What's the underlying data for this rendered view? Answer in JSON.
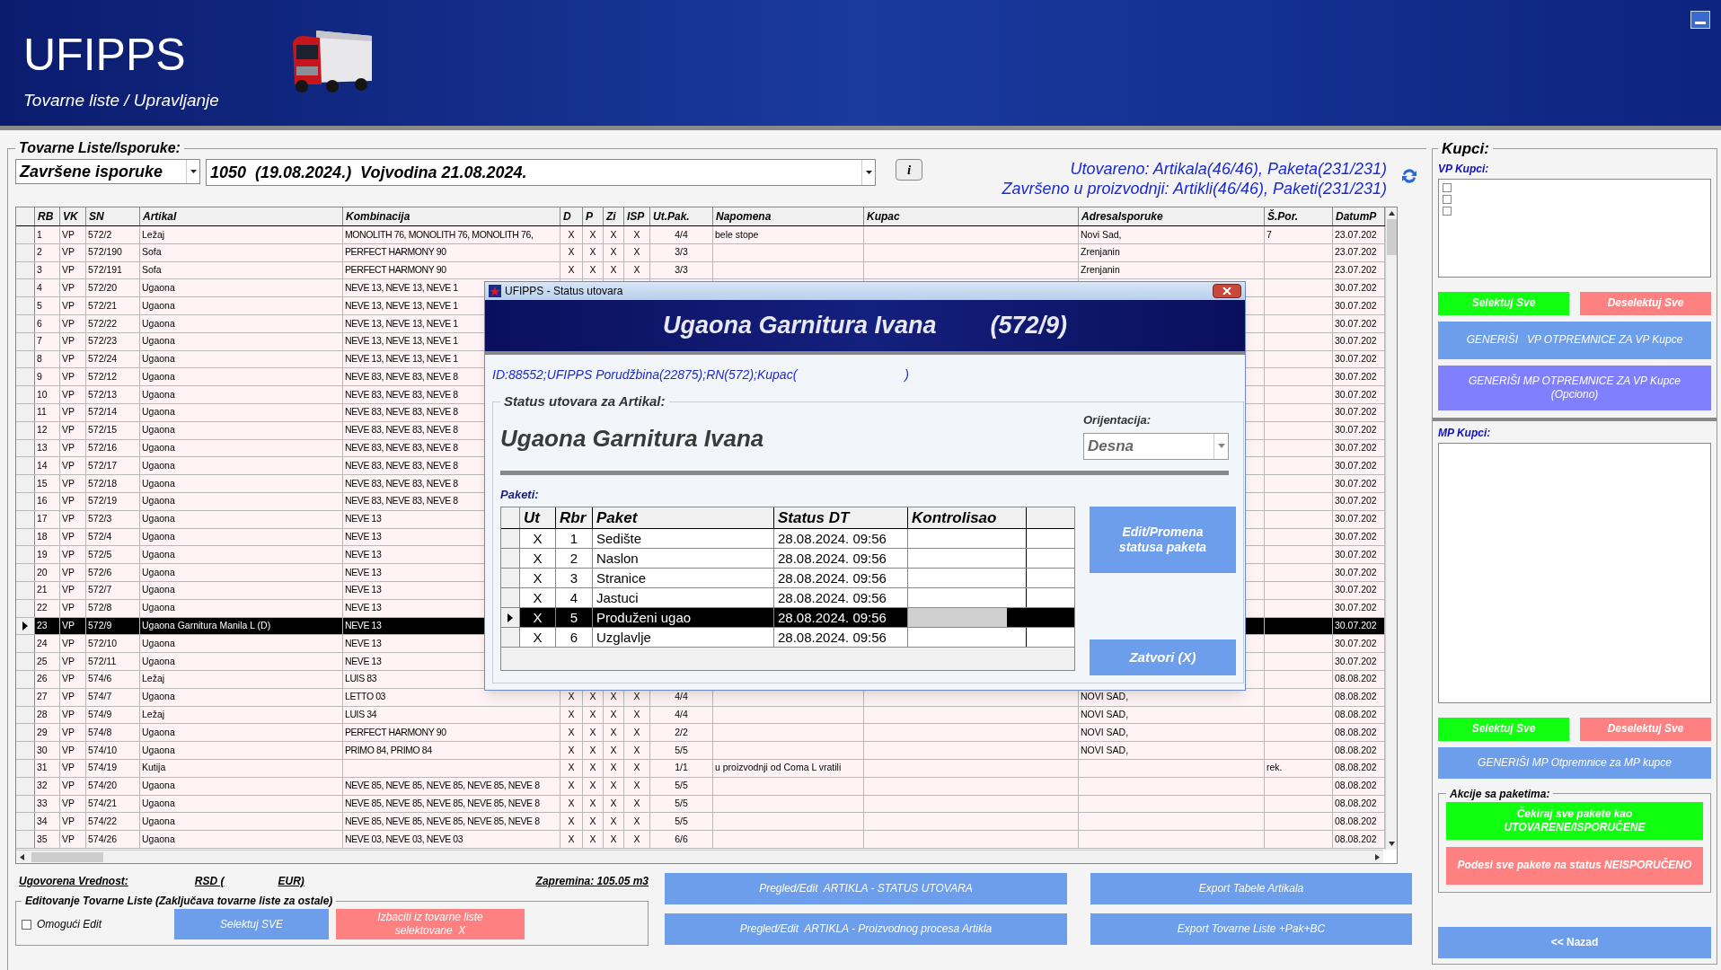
{
  "header": {
    "title": "UFIPPS",
    "subtitle": "Tovarne liste / Upravljanje"
  },
  "tovarne": {
    "legend": "Tovarne Liste/Isporuke:",
    "filter": "Završene isporuke",
    "list": "1050  (19.08.2024.)  Vojvodina 21.08.2024.",
    "info_button": "i",
    "status_1": "Utovareno: Artikala(46/46), Paketa(231/231)",
    "status_2": "Završeno u proizvodnji: Artikli(46/46), Paketi(231/231)"
  },
  "table": {
    "columns": [
      "RB",
      "VK",
      "SN",
      "Artikal",
      "Kombinacija",
      "D",
      "P",
      "Zi",
      "ISP",
      "Ut.Pak.",
      "Napomena",
      "Kupac",
      "Adresalsporuke",
      "Š.Por.",
      "DatumP"
    ],
    "rows": [
      {
        "rb": "1",
        "vk": "VP",
        "sn": "572/2",
        "artikal": "Ležaj",
        "kombinacija": "MONOLITH 76, MONOLITH 76, MONOLITH 76,",
        "d": "X",
        "p": "X",
        "zi": "X",
        "isp": "X",
        "ut_pak": "4/4",
        "napomena": "bele stope",
        "adresa": "Novi Sad,",
        "s_por": "7",
        "datum": "23.07.202",
        "selected": false
      },
      {
        "rb": "2",
        "vk": "VP",
        "sn": "572/190",
        "artikal": "Sofa",
        "kombinacija": "PERFECT HARMONY 90",
        "d": "X",
        "p": "X",
        "zi": "X",
        "isp": "X",
        "ut_pak": "3/3",
        "adresa": "Zrenjanin",
        "datum": "23.07.202",
        "selected": false
      },
      {
        "rb": "3",
        "vk": "VP",
        "sn": "572/191",
        "artikal": "Sofa",
        "kombinacija": "PERFECT HARMONY 90",
        "d": "X",
        "p": "X",
        "zi": "X",
        "isp": "X",
        "ut_pak": "3/3",
        "adresa": "Zrenjanin",
        "datum": "23.07.202",
        "selected": false
      },
      {
        "rb": "4",
        "vk": "VP",
        "sn": "572/20",
        "artikal": "Ugaona",
        "kombinacija": "NEVE 13, NEVE 13, NEVE 1",
        "datum": "30.07.202",
        "selected": false
      },
      {
        "rb": "5",
        "vk": "VP",
        "sn": "572/21",
        "artikal": "Ugaona",
        "kombinacija": "NEVE 13, NEVE 13, NEVE 1",
        "datum": "30.07.202",
        "selected": false
      },
      {
        "rb": "6",
        "vk": "VP",
        "sn": "572/22",
        "artikal": "Ugaona",
        "kombinacija": "NEVE 13, NEVE 13, NEVE 1",
        "datum": "30.07.202",
        "selected": false
      },
      {
        "rb": "7",
        "vk": "VP",
        "sn": "572/23",
        "artikal": "Ugaona",
        "kombinacija": "NEVE 13, NEVE 13, NEVE 1",
        "datum": "30.07.202",
        "selected": false
      },
      {
        "rb": "8",
        "vk": "VP",
        "sn": "572/24",
        "artikal": "Ugaona",
        "kombinacija": "NEVE 13, NEVE 13, NEVE 1",
        "datum": "30.07.202",
        "selected": false
      },
      {
        "rb": "9",
        "vk": "VP",
        "sn": "572/12",
        "artikal": "Ugaona",
        "kombinacija": "NEVE 83, NEVE 83, NEVE 8",
        "datum": "30.07.202",
        "selected": false
      },
      {
        "rb": "10",
        "vk": "VP",
        "sn": "572/13",
        "artikal": "Ugaona",
        "kombinacija": "NEVE 83, NEVE 83, NEVE 8",
        "datum": "30.07.202",
        "selected": false
      },
      {
        "rb": "11",
        "vk": "VP",
        "sn": "572/14",
        "artikal": "Ugaona",
        "kombinacija": "NEVE 83, NEVE 83, NEVE 8",
        "datum": "30.07.202",
        "selected": false
      },
      {
        "rb": "12",
        "vk": "VP",
        "sn": "572/15",
        "artikal": "Ugaona",
        "kombinacija": "NEVE 83, NEVE 83, NEVE 8",
        "datum": "30.07.202",
        "selected": false
      },
      {
        "rb": "13",
        "vk": "VP",
        "sn": "572/16",
        "artikal": "Ugaona",
        "kombinacija": "NEVE 83, NEVE 83, NEVE 8",
        "datum": "30.07.202",
        "selected": false
      },
      {
        "rb": "14",
        "vk": "VP",
        "sn": "572/17",
        "artikal": "Ugaona",
        "kombinacija": "NEVE 83, NEVE 83, NEVE 8",
        "datum": "30.07.202",
        "selected": false
      },
      {
        "rb": "15",
        "vk": "VP",
        "sn": "572/18",
        "artikal": "Ugaona",
        "kombinacija": "NEVE 83, NEVE 83, NEVE 8",
        "datum": "30.07.202",
        "selected": false
      },
      {
        "rb": "16",
        "vk": "VP",
        "sn": "572/19",
        "artikal": "Ugaona",
        "kombinacija": "NEVE 83, NEVE 83, NEVE 8",
        "datum": "30.07.202",
        "selected": false
      },
      {
        "rb": "17",
        "vk": "VP",
        "sn": "572/3",
        "artikal": "Ugaona",
        "kombinacija": "NEVE 13",
        "datum": "30.07.202",
        "selected": false
      },
      {
        "rb": "18",
        "vk": "VP",
        "sn": "572/4",
        "artikal": "Ugaona",
        "kombinacija": "NEVE 13",
        "datum": "30.07.202",
        "selected": false
      },
      {
        "rb": "19",
        "vk": "VP",
        "sn": "572/5",
        "artikal": "Ugaona",
        "kombinacija": "NEVE 13",
        "datum": "30.07.202",
        "selected": false
      },
      {
        "rb": "20",
        "vk": "VP",
        "sn": "572/6",
        "artikal": "Ugaona",
        "kombinacija": "NEVE 13",
        "datum": "30.07.202",
        "selected": false
      },
      {
        "rb": "21",
        "vk": "VP",
        "sn": "572/7",
        "artikal": "Ugaona",
        "kombinacija": "NEVE 13",
        "datum": "30.07.202",
        "selected": false
      },
      {
        "rb": "22",
        "vk": "VP",
        "sn": "572/8",
        "artikal": "Ugaona",
        "kombinacija": "NEVE 13",
        "datum": "30.07.202",
        "selected": false
      },
      {
        "rb": "23",
        "vk": "VP",
        "sn": "572/9",
        "artikal": "Ugaona Garnitura Manila L (D)",
        "kombinacija": "NEVE 13",
        "datum": "30.07.202",
        "selected": true
      },
      {
        "rb": "24",
        "vk": "VP",
        "sn": "572/10",
        "artikal": "Ugaona",
        "kombinacija": "NEVE 13",
        "datum": "30.07.202",
        "selected": false
      },
      {
        "rb": "25",
        "vk": "VP",
        "sn": "572/11",
        "artikal": "Ugaona",
        "kombinacija": "NEVE 13",
        "datum": "30.07.202",
        "selected": false
      },
      {
        "rb": "26",
        "vk": "VP",
        "sn": "574/6",
        "artikal": "Ležaj",
        "kombinacija": "LUIS 83",
        "datum": "08.08.202",
        "selected": false
      },
      {
        "rb": "27",
        "vk": "VP",
        "sn": "574/7",
        "artikal": "Ugaona",
        "kombinacija": "LETTO 03",
        "d": "X",
        "p": "X",
        "zi": "X",
        "isp": "X",
        "ut_pak": "4/4",
        "adresa": "NOVI SAD,",
        "datum": "08.08.202",
        "selected": false
      },
      {
        "rb": "28",
        "vk": "VP",
        "sn": "574/9",
        "artikal": "Ležaj",
        "kombinacija": "LUIS 34",
        "d": "X",
        "p": "X",
        "zi": "X",
        "isp": "X",
        "ut_pak": "4/4",
        "adresa": "NOVI SAD,",
        "datum": "08.08.202",
        "selected": false
      },
      {
        "rb": "29",
        "vk": "VP",
        "sn": "574/8",
        "artikal": "Ugaona",
        "kombinacija": "PERFECT HARMONY 90",
        "d": "X",
        "p": "X",
        "zi": "X",
        "isp": "X",
        "ut_pak": "2/2",
        "adresa": "NOVI SAD,",
        "datum": "08.08.202",
        "selected": false
      },
      {
        "rb": "30",
        "vk": "VP",
        "sn": "574/10",
        "artikal": "Ugaona",
        "kombinacija": "PRIMO 84, PRIMO 84",
        "d": "X",
        "p": "X",
        "zi": "X",
        "isp": "X",
        "ut_pak": "5/5",
        "adresa": "NOVI SAD,",
        "datum": "08.08.202",
        "selected": false
      },
      {
        "rb": "31",
        "vk": "VP",
        "sn": "574/19",
        "artikal": "Kutija",
        "d": "X",
        "p": "X",
        "zi": "X",
        "isp": "X",
        "ut_pak": "1/1",
        "napomena": "u proizvodnji od Coma L vratili",
        "s_por": "rek.",
        "datum": "08.08.202",
        "selected": false
      },
      {
        "rb": "32",
        "vk": "VP",
        "sn": "574/20",
        "artikal": "Ugaona",
        "kombinacija": "NEVE 85, NEVE 85, NEVE 85, NEVE 85, NEVE 8",
        "d": "X",
        "p": "X",
        "zi": "X",
        "isp": "X",
        "ut_pak": "5/5",
        "datum": "08.08.202",
        "selected": false
      },
      {
        "rb": "33",
        "vk": "VP",
        "sn": "574/21",
        "artikal": "Ugaona",
        "kombinacija": "NEVE 85, NEVE 85, NEVE 85, NEVE 85, NEVE 8",
        "d": "X",
        "p": "X",
        "zi": "X",
        "isp": "X",
        "ut_pak": "5/5",
        "datum": "08.08.202",
        "selected": false
      },
      {
        "rb": "34",
        "vk": "VP",
        "sn": "574/22",
        "artikal": "Ugaona",
        "kombinacija": "NEVE 85, NEVE 85, NEVE 85, NEVE 85, NEVE 8",
        "d": "X",
        "p": "X",
        "zi": "X",
        "isp": "X",
        "ut_pak": "5/5",
        "datum": "08.08.202",
        "selected": false
      },
      {
        "rb": "35",
        "vk": "VP",
        "sn": "574/26",
        "artikal": "Ugaona",
        "kombinacija": "NEVE 03, NEVE 03, NEVE 03",
        "d": "X",
        "p": "X",
        "zi": "X",
        "isp": "X",
        "ut_pak": "6/6",
        "datum": "08.08.202",
        "selected": false
      }
    ]
  },
  "dialog": {
    "title": "UFIPPS - Status utovara",
    "heading": "Ugaona Garnitura Ivana",
    "heading_code": "(572/9)",
    "info_prefix": "ID:88552;UFIPPS Porudžbina(22875);RN(572);Kupac(",
    "info_suffix": ")",
    "group": "Status utovara za Artikal:",
    "article": "Ugaona Garnitura Ivana",
    "orientation_label": "Orijentacija:",
    "orientation": "Desna",
    "packages_label": "Paketi:",
    "columns": [
      "Ut",
      "Rbr",
      "Paket",
      "Status DT",
      "Kontrolisao"
    ],
    "packages": [
      {
        "ut": "X",
        "rbr": "1",
        "paket": "Sedište",
        "status_dt": "28.08.2024. 09:56",
        "selected": false
      },
      {
        "ut": "X",
        "rbr": "2",
        "paket": "Naslon",
        "status_dt": "28.08.2024. 09:56",
        "selected": false
      },
      {
        "ut": "X",
        "rbr": "3",
        "paket": "Stranice",
        "status_dt": "28.08.2024. 09:56",
        "selected": false
      },
      {
        "ut": "X",
        "rbr": "4",
        "paket": "Jastuci",
        "status_dt": "28.08.2024. 09:56",
        "selected": false
      },
      {
        "ut": "X",
        "rbr": "5",
        "paket": "Produženi ugao",
        "status_dt": "28.08.2024. 09:56",
        "selected": true
      },
      {
        "ut": "X",
        "rbr": "6",
        "paket": "Uzglavlje",
        "status_dt": "28.08.2024. 09:56",
        "selected": false
      }
    ],
    "edit_button": "Edit/Promena statusa paketa",
    "close_button": "Zatvori (X)"
  },
  "bottom": {
    "value_label": "Ugovorena Vrednost:",
    "value_rsd": "RSD (",
    "value_eur": "EUR)",
    "volume": "Zapremina: 105.05 m3",
    "edit_group": "Editovanje Tovarne Liste (Zaključava tovarne liste za ostale)",
    "edit_checkbox": {
      "label": "Omogući Edit",
      "checked": false
    },
    "select_all": "Selektuj SVE",
    "remove": "Izbaciti iz tovarne liste selektovane  X",
    "buttons": [
      "Pregled/Edit  ARTIKLA - STATUS UTOVARA",
      "Export Tabele Artikala",
      "Pregled/Edit  ARTIKLA - Proizvodnog procesa Artikla",
      "Export Tovarne Liste +Pak+BC"
    ]
  },
  "kupci": {
    "legend": "Kupci:",
    "vp_label": "VP Kupci:",
    "vp_items": [
      {
        "checked": false
      },
      {
        "checked": false
      },
      {
        "checked": false
      }
    ],
    "vp_select": "Selektuj Sve",
    "vp_deselect": "Deselektuj Sve",
    "gen_vp": "GENERIŠI   VP OTPREMNICE ZA VP Kupce",
    "gen_mp_vp": "GENERIŠI MP OTPREMNICE ZA VP Kupce (Opciono)",
    "mp_label": "MP Kupci:",
    "mp_select": "Selektuj Sve",
    "mp_deselect": "Deselektuj Sve",
    "gen_mp": "GENERIŠI MP Otpremnice za MP kupce",
    "actions_legend": "Akcije sa paketima:",
    "check_all": "Čekiraj sve pakete kao UTOVARENE/ISPORUČENE",
    "set_undelivered": "Podesi sve pakete na status NEISPORUČENO",
    "back": "<< Nazad"
  }
}
